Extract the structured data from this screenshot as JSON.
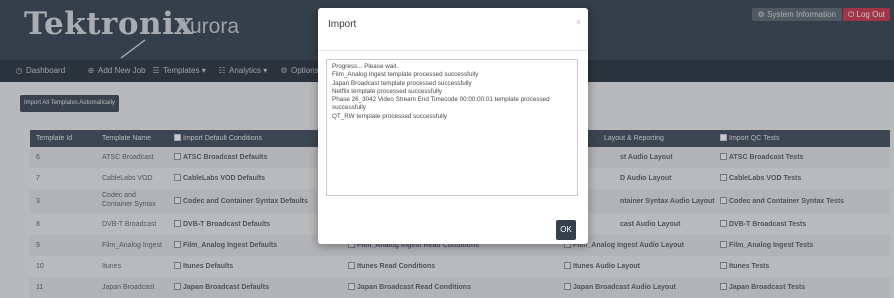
{
  "header": {
    "brand": "Tektronix",
    "product": "Aurora",
    "system_info": "System Information",
    "logout": "Log Out"
  },
  "nav": {
    "dashboard": "Dashboard",
    "add_new_job": "Add New Job",
    "templates": "Templates",
    "analytics": "Analytics",
    "options": "Options"
  },
  "toolbar": {
    "import_all": "Import All Templates Automatically"
  },
  "table": {
    "headers": {
      "template_id": "Template Id",
      "template_name": "Template Name",
      "default_conditions": "Import Default Conditions",
      "layout_reporting": "Layout & Reporting",
      "qc_tests": "Import QC Tests"
    },
    "rows": [
      {
        "id": "6",
        "name": "ATSC Broadcast",
        "defaults": "ATSC Broadcast Defaults",
        "read": "",
        "layout": "st Audio Layout",
        "qc": "ATSC Broadcast Tests"
      },
      {
        "id": "7",
        "name": "CableLabs VOD",
        "defaults": "CableLabs VOD Defaults",
        "read": "",
        "layout": "D Audio Layout",
        "qc": "CableLabs VOD Tests"
      },
      {
        "id": "3",
        "name": "Codec and Container Syntax",
        "defaults": "Codec and Container Syntax Defaults",
        "read": "",
        "layout": "ntainer Syntax Audio Layout",
        "qc": "Codec and Container Syntax Tests"
      },
      {
        "id": "8",
        "name": "DVB-T Broadcast",
        "defaults": "DVB-T Broadcast Defaults",
        "read": "",
        "layout": "cast Audio Layout",
        "qc": "DVB-T Broadcast Tests"
      },
      {
        "id": "9",
        "name": "Film_Analog Ingest",
        "defaults": "Film_Analog Ingest Defaults",
        "read": "Film_Analog Ingest Read Conditions",
        "layout": "Film_Analog Ingest Audio Layout",
        "qc": "Film_Analog Ingest Tests"
      },
      {
        "id": "10",
        "name": "Itunes",
        "defaults": "Itunes Defaults",
        "read": "Itunes Read Conditions",
        "layout": "Itunes Audio Layout",
        "qc": "Itunes Tests"
      },
      {
        "id": "11",
        "name": "Japan Broadcast",
        "defaults": "Japan Broadcast Defaults",
        "read": "Japan Broadcast Read Conditions",
        "layout": "Japan Broadcast Audio Layout",
        "qc": "Japan Broadcast Tests"
      }
    ]
  },
  "modal": {
    "title": "Import",
    "close": "×",
    "log": [
      "Progress... Please wait.",
      "Film_Analog Ingest template processed successfully",
      "Japan Broadcast template processed successfully",
      "Netflix template processed successfully",
      "Phase 26_3042 Video Stream End Timecode 00:00:00:01 template processed successfully",
      "QT_RW template processed successfully"
    ],
    "ok": "OK"
  },
  "colors": {
    "header_bg": "#34404e",
    "nav_bg": "#26303c",
    "table_header_bg": "#3e4a58",
    "logout_red": "#c8334a",
    "ok_button": "#34404e"
  },
  "icons": {
    "dashboard": "clock-icon",
    "add_new_job": "plus-circle-icon",
    "templates": "list-icon",
    "analytics": "list-icon",
    "options": "gears-icon",
    "system_info": "gear-icon",
    "logout": "power-icon",
    "checkbox": "checkbox-icon"
  }
}
